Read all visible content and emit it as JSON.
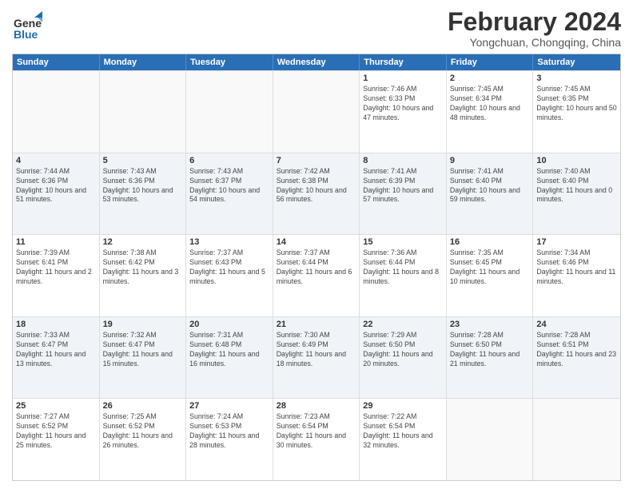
{
  "logo": {
    "line1": "General",
    "line2": "Blue"
  },
  "title": "February 2024",
  "subtitle": "Yongchuan, Chongqing, China",
  "days_of_week": [
    "Sunday",
    "Monday",
    "Tuesday",
    "Wednesday",
    "Thursday",
    "Friday",
    "Saturday"
  ],
  "weeks": [
    [
      {
        "day": "",
        "empty": true
      },
      {
        "day": "",
        "empty": true
      },
      {
        "day": "",
        "empty": true
      },
      {
        "day": "",
        "empty": true
      },
      {
        "day": "1",
        "rise": "7:46 AM",
        "set": "6:33 PM",
        "daylight": "10 hours and 47 minutes."
      },
      {
        "day": "2",
        "rise": "7:45 AM",
        "set": "6:34 PM",
        "daylight": "10 hours and 48 minutes."
      },
      {
        "day": "3",
        "rise": "7:45 AM",
        "set": "6:35 PM",
        "daylight": "10 hours and 50 minutes."
      }
    ],
    [
      {
        "day": "4",
        "rise": "7:44 AM",
        "set": "6:36 PM",
        "daylight": "10 hours and 51 minutes."
      },
      {
        "day": "5",
        "rise": "7:43 AM",
        "set": "6:36 PM",
        "daylight": "10 hours and 53 minutes."
      },
      {
        "day": "6",
        "rise": "7:43 AM",
        "set": "6:37 PM",
        "daylight": "10 hours and 54 minutes."
      },
      {
        "day": "7",
        "rise": "7:42 AM",
        "set": "6:38 PM",
        "daylight": "10 hours and 56 minutes."
      },
      {
        "day": "8",
        "rise": "7:41 AM",
        "set": "6:39 PM",
        "daylight": "10 hours and 57 minutes."
      },
      {
        "day": "9",
        "rise": "7:41 AM",
        "set": "6:40 PM",
        "daylight": "10 hours and 59 minutes."
      },
      {
        "day": "10",
        "rise": "7:40 AM",
        "set": "6:40 PM",
        "daylight": "11 hours and 0 minutes."
      }
    ],
    [
      {
        "day": "11",
        "rise": "7:39 AM",
        "set": "6:41 PM",
        "daylight": "11 hours and 2 minutes."
      },
      {
        "day": "12",
        "rise": "7:38 AM",
        "set": "6:42 PM",
        "daylight": "11 hours and 3 minutes."
      },
      {
        "day": "13",
        "rise": "7:37 AM",
        "set": "6:43 PM",
        "daylight": "11 hours and 5 minutes."
      },
      {
        "day": "14",
        "rise": "7:37 AM",
        "set": "6:44 PM",
        "daylight": "11 hours and 6 minutes."
      },
      {
        "day": "15",
        "rise": "7:36 AM",
        "set": "6:44 PM",
        "daylight": "11 hours and 8 minutes."
      },
      {
        "day": "16",
        "rise": "7:35 AM",
        "set": "6:45 PM",
        "daylight": "11 hours and 10 minutes."
      },
      {
        "day": "17",
        "rise": "7:34 AM",
        "set": "6:46 PM",
        "daylight": "11 hours and 11 minutes."
      }
    ],
    [
      {
        "day": "18",
        "rise": "7:33 AM",
        "set": "6:47 PM",
        "daylight": "11 hours and 13 minutes."
      },
      {
        "day": "19",
        "rise": "7:32 AM",
        "set": "6:47 PM",
        "daylight": "11 hours and 15 minutes."
      },
      {
        "day": "20",
        "rise": "7:31 AM",
        "set": "6:48 PM",
        "daylight": "11 hours and 16 minutes."
      },
      {
        "day": "21",
        "rise": "7:30 AM",
        "set": "6:49 PM",
        "daylight": "11 hours and 18 minutes."
      },
      {
        "day": "22",
        "rise": "7:29 AM",
        "set": "6:50 PM",
        "daylight": "11 hours and 20 minutes."
      },
      {
        "day": "23",
        "rise": "7:28 AM",
        "set": "6:50 PM",
        "daylight": "11 hours and 21 minutes."
      },
      {
        "day": "24",
        "rise": "7:28 AM",
        "set": "6:51 PM",
        "daylight": "11 hours and 23 minutes."
      }
    ],
    [
      {
        "day": "25",
        "rise": "7:27 AM",
        "set": "6:52 PM",
        "daylight": "11 hours and 25 minutes."
      },
      {
        "day": "26",
        "rise": "7:25 AM",
        "set": "6:52 PM",
        "daylight": "11 hours and 26 minutes."
      },
      {
        "day": "27",
        "rise": "7:24 AM",
        "set": "6:53 PM",
        "daylight": "11 hours and 28 minutes."
      },
      {
        "day": "28",
        "rise": "7:23 AM",
        "set": "6:54 PM",
        "daylight": "11 hours and 30 minutes."
      },
      {
        "day": "29",
        "rise": "7:22 AM",
        "set": "6:54 PM",
        "daylight": "11 hours and 32 minutes."
      },
      {
        "day": "",
        "empty": true
      },
      {
        "day": "",
        "empty": true
      }
    ]
  ]
}
